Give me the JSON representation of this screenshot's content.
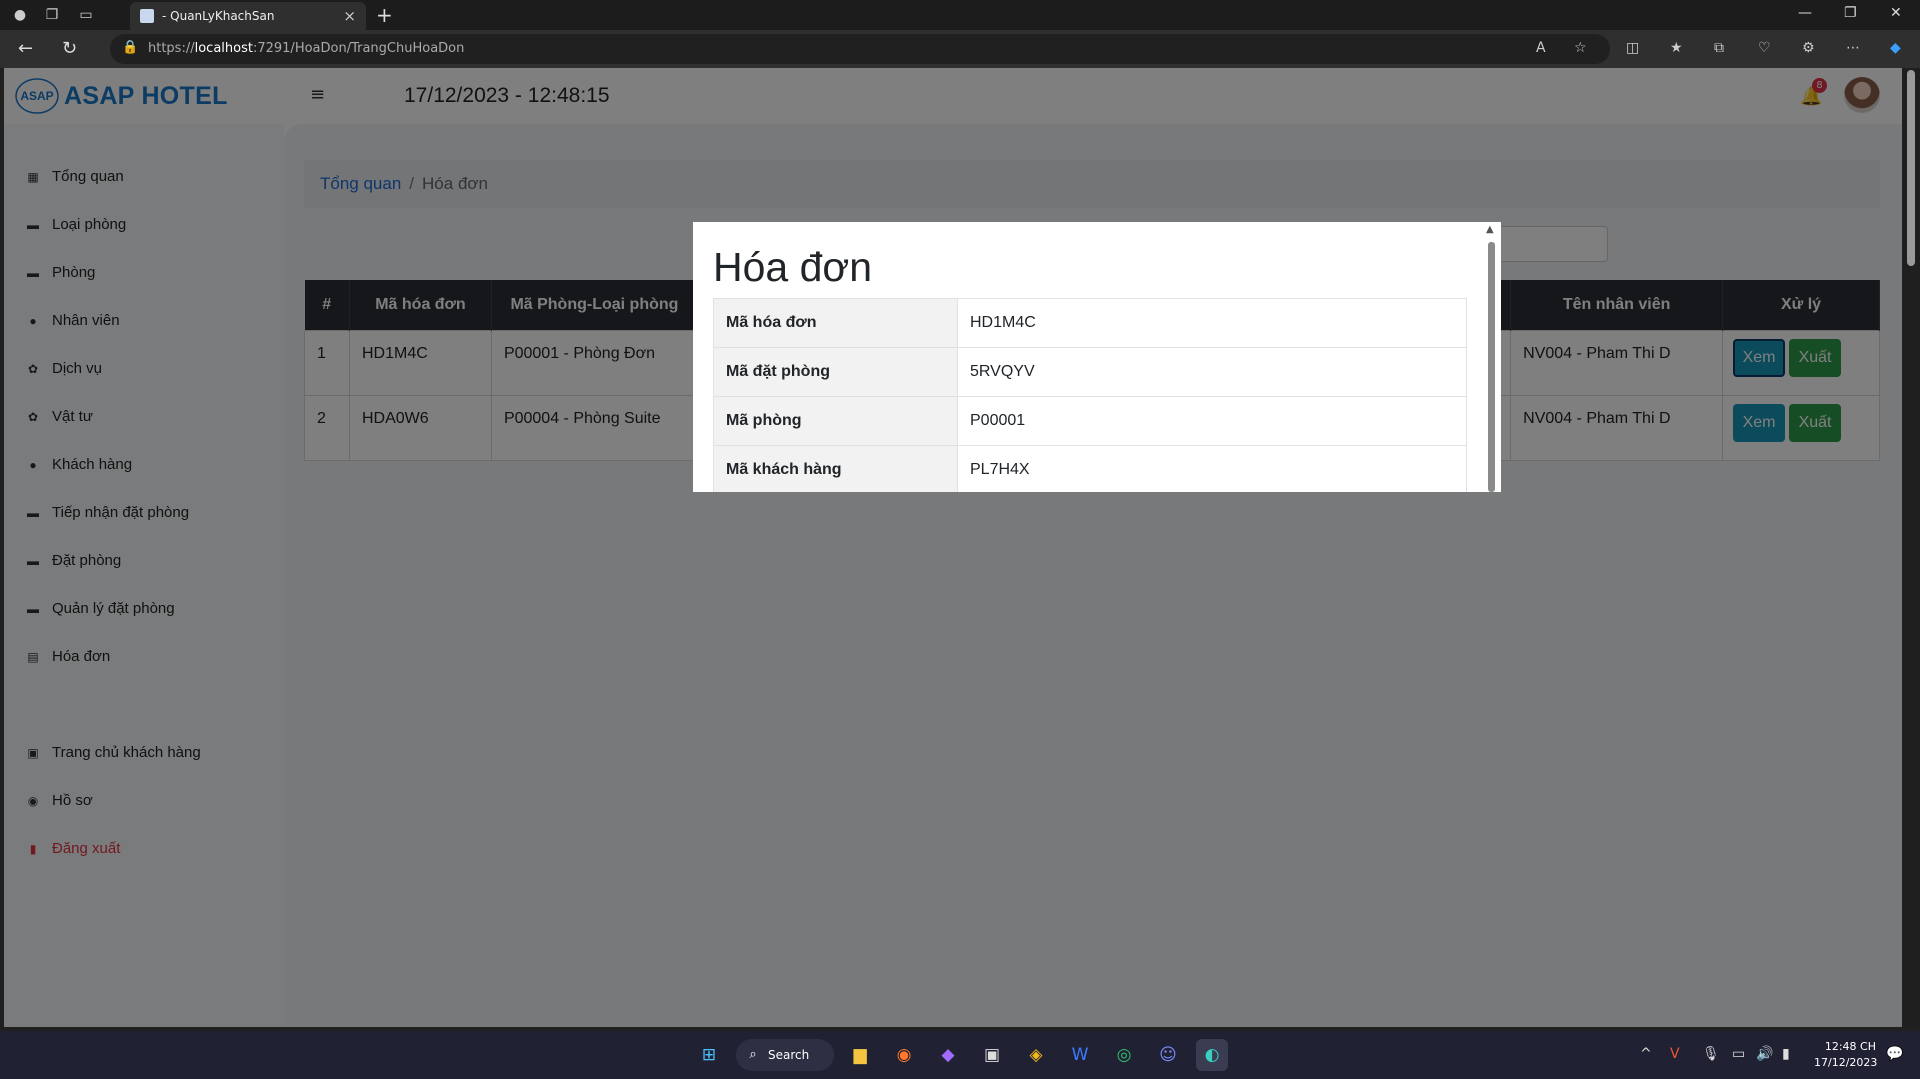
{
  "browser": {
    "tab_title": "- QuanLyKhachSan",
    "url_prefix": "https://",
    "url_host": "localhost",
    "url_rest": ":7291/HoaDon/TrangChuHoaDon"
  },
  "header": {
    "brand": "ASAP HOTEL",
    "logo_text": "ASAP",
    "datetime": "17/12/2023 - 12:48:15",
    "notification_count": "8"
  },
  "sidebar": {
    "items": [
      {
        "label": "Tổng quan",
        "icon": "dashboard-icon"
      },
      {
        "label": "Loại phòng",
        "icon": "bed-icon"
      },
      {
        "label": "Phòng",
        "icon": "bed-icon"
      },
      {
        "label": "Nhân viên",
        "icon": "users-icon"
      },
      {
        "label": "Dịch vụ",
        "icon": "gear-icon"
      },
      {
        "label": "Vật tư",
        "icon": "gear-icon"
      },
      {
        "label": "Khách hàng",
        "icon": "user-icon"
      },
      {
        "label": "Tiếp nhận đặt phòng",
        "icon": "bed-icon"
      },
      {
        "label": "Đặt phòng",
        "icon": "bed-icon"
      },
      {
        "label": "Quản lý đặt phòng",
        "icon": "bed-icon"
      },
      {
        "label": "Hóa đơn",
        "icon": "receipt-icon"
      }
    ],
    "bottom_items": [
      {
        "label": "Trang chủ khách hàng",
        "icon": "home-icon"
      },
      {
        "label": "Hồ sơ",
        "icon": "profile-icon"
      },
      {
        "label": "Đăng xuất",
        "icon": "logout-icon"
      }
    ]
  },
  "breadcrumb": {
    "root": "Tổng quan",
    "separator": "/",
    "current": "Hóa đơn"
  },
  "table": {
    "headers": [
      "#",
      "Mã hóa đơn",
      "Mã Phòng-Loại phòng",
      "Tên nhân viên",
      "Xử lý"
    ],
    "rows": [
      {
        "index": "1",
        "ma_hoa_don": "HD1M4C",
        "phong": "P00001 - Phòng Đơn",
        "nhan_vien": "NV004 - Pham Thi D"
      },
      {
        "index": "2",
        "ma_hoa_don": "HDA0W6",
        "phong": "P00004 - Phòng Suite",
        "nhan_vien": "NV004 - Pham Thi D"
      }
    ],
    "view_label": "Xem",
    "export_label": "Xuất"
  },
  "modal": {
    "title": "Hóa đơn",
    "fields": [
      {
        "key": "Mã hóa đơn",
        "value": "HD1M4C"
      },
      {
        "key": "Mã đặt phòng",
        "value": "5RVQYV"
      },
      {
        "key": "Mã phòng",
        "value": "P00001"
      },
      {
        "key": "Mã khách hàng",
        "value": "PL7H4X"
      }
    ]
  },
  "taskbar": {
    "search_label": "Search",
    "time": "12:48 CH",
    "date": "17/12/2023"
  },
  "colors": {
    "brand": "#1877c9",
    "table_header": "#2b2f36",
    "xem_button": "#1797b6",
    "xuat_button": "#2f9a4a",
    "logout": "#e5333f"
  }
}
